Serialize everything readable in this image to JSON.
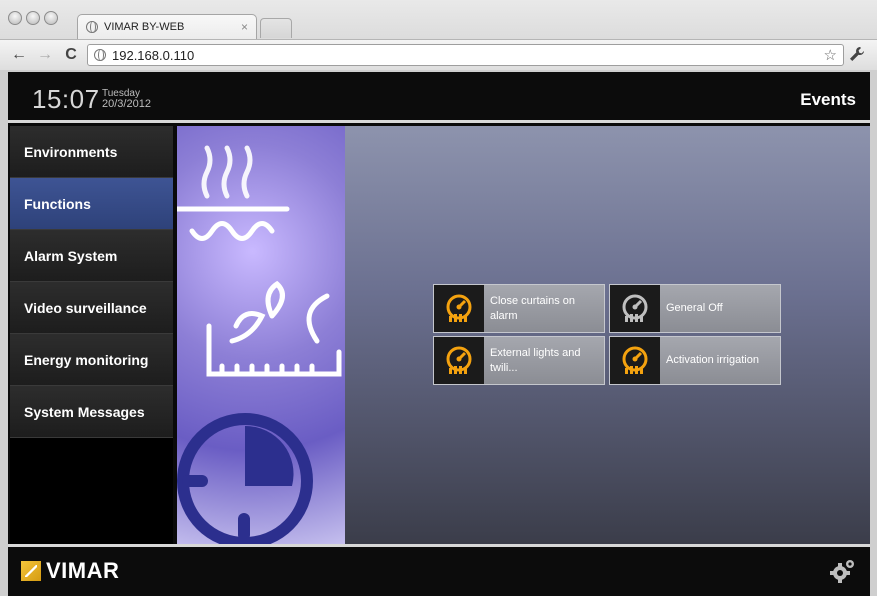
{
  "browser": {
    "tab_title": "VIMAR BY-WEB",
    "tab_close": "×",
    "url": "192.168.0.110",
    "back_icon": "←",
    "forward_icon": "→",
    "reload_icon": "C",
    "star_icon": "☆",
    "wrench_icon": "🔧"
  },
  "header": {
    "time": "15:07",
    "day": "Tuesday",
    "date": "20/3/2012",
    "title": "Events"
  },
  "sidebar": {
    "items": [
      {
        "label": "Environments",
        "active": false
      },
      {
        "label": "Functions",
        "active": true
      },
      {
        "label": "Alarm System",
        "active": false
      },
      {
        "label": "Video surveillance",
        "active": false
      },
      {
        "label": "Energy monitoring",
        "active": false
      },
      {
        "label": "System Messages",
        "active": false
      }
    ]
  },
  "events": [
    {
      "label": "Close curtains on alarm",
      "icon": "event-gauge-icon",
      "color": "#f4a20f"
    },
    {
      "label": "General Off",
      "icon": "event-gauge-icon",
      "color": "#bfbfbf"
    },
    {
      "label": "External lights and twili...",
      "icon": "event-gauge-icon",
      "color": "#f4a20f"
    },
    {
      "label": "Activation irrigation",
      "icon": "event-gauge-icon",
      "color": "#f4a20f"
    }
  ],
  "footer": {
    "logo_text": "VIMAR",
    "settings_icon": "gear-icon"
  },
  "colors": {
    "active_nav": "#3e5494",
    "event_icon_active": "#f4a20f",
    "event_icon_inactive": "#bfbfbf"
  }
}
